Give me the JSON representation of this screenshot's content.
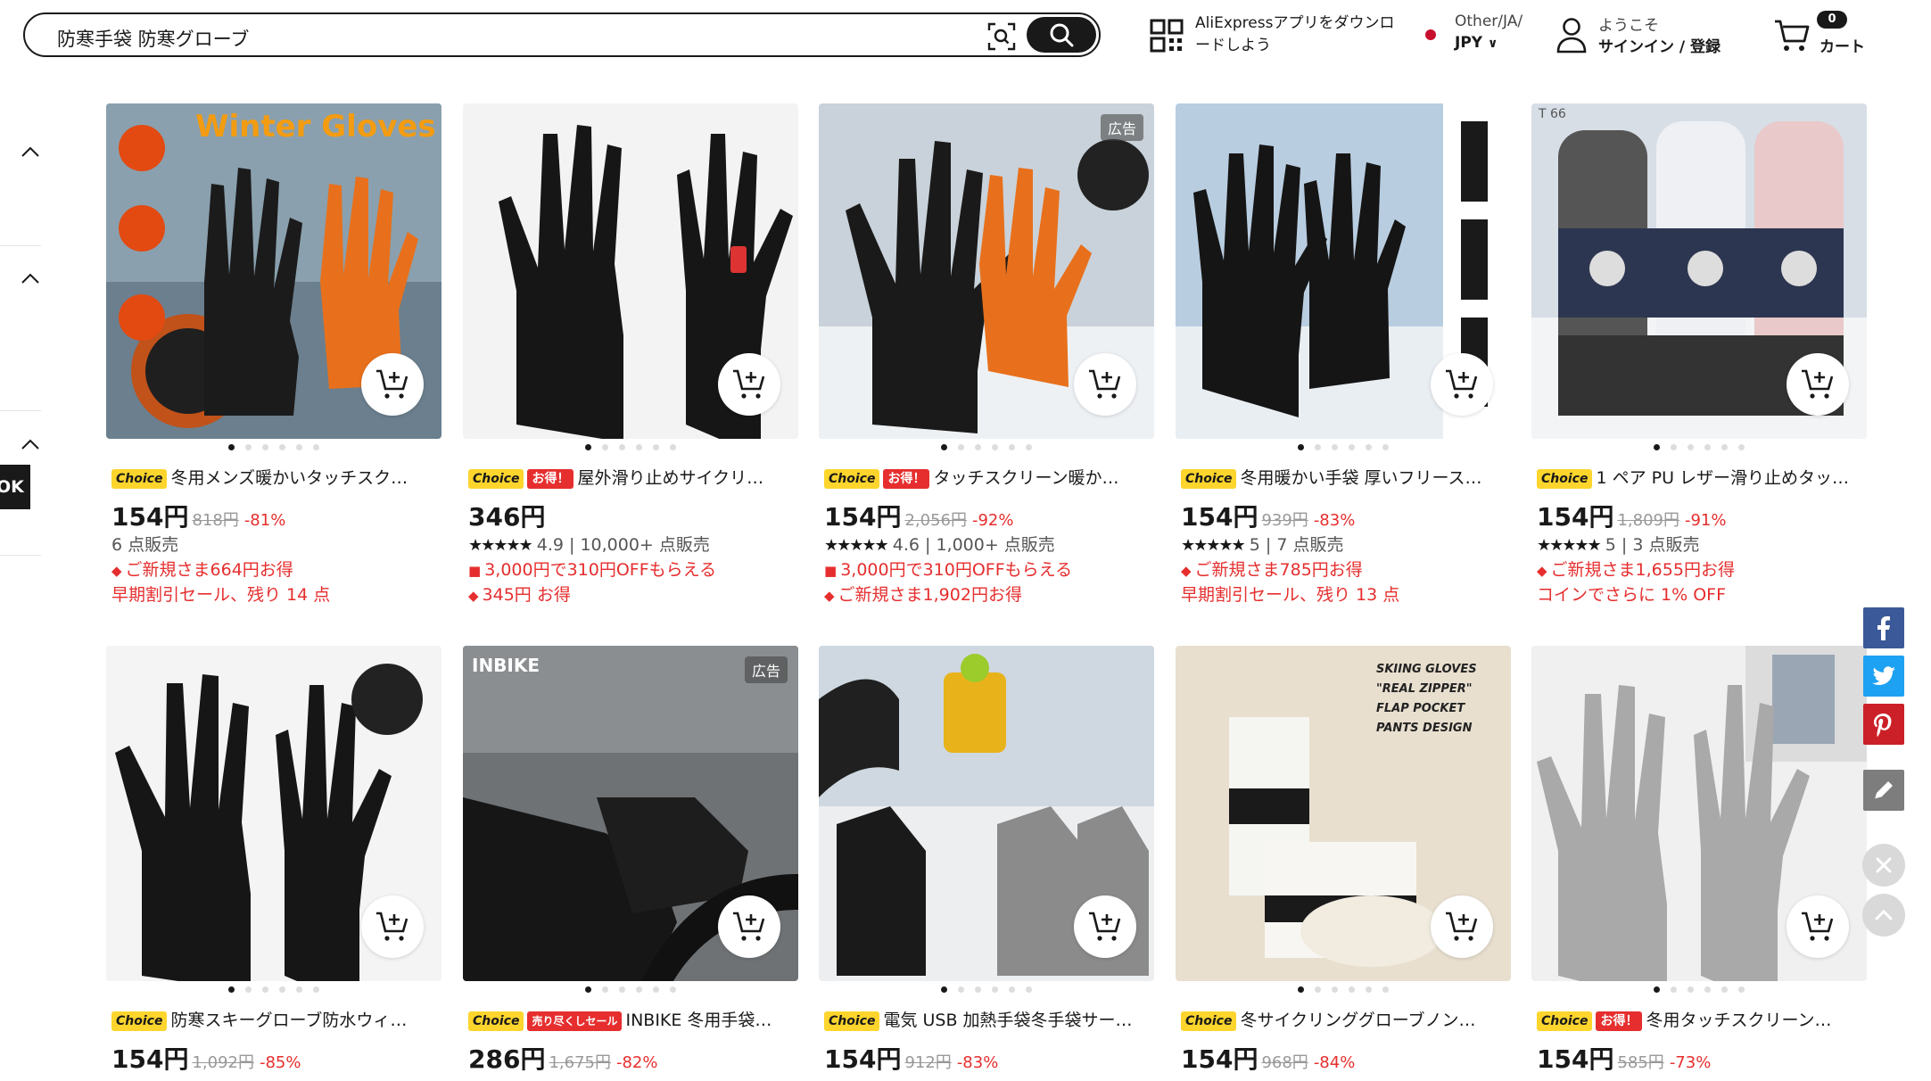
{
  "header": {
    "search_query": "防寒手袋 防寒グローブ",
    "app_download": "AliExpressアプリをダウンロードしよう",
    "region_top": "Other/JA/",
    "currency": "JPY",
    "welcome": "ようこそ",
    "signin": "サインイン / 登録",
    "cart_count": "0",
    "cart_label": "カート"
  },
  "left_panel": {
    "ok_label": "OK"
  },
  "ad_label": "広告",
  "products": [
    {
      "img_text": "Winter Gloves",
      "badges": [
        "Choice"
      ],
      "title": "冬用メンズ暖かいタッチスク…",
      "price": "154円",
      "orig": "818円",
      "disc": "-81%",
      "meta_rating": "",
      "meta": "6 点販売",
      "promos": [
        "ご新規さま664円お得",
        "早期割引セール、残り 14 点"
      ]
    },
    {
      "img_text": "",
      "badges": [
        "Choice",
        "お得！"
      ],
      "title": "屋外滑り止めサイクリ…",
      "price": "346円",
      "orig": "",
      "disc": "",
      "meta_rating": "4.9",
      "meta": "10,000+ 点販売",
      "promos": [
        "3,000円で310円OFFもらえる",
        "345円 お得"
      ]
    },
    {
      "img_text": "",
      "badges": [
        "Choice",
        "お得！"
      ],
      "title": "タッチスクリーン暖か…",
      "price": "154円",
      "orig": "2,056円",
      "disc": "-92%",
      "meta_rating": "4.6",
      "meta": "1,000+ 点販売",
      "promos": [
        "3,000円で310円OFFもらえる",
        "ご新規さま1,902円お得"
      ]
    },
    {
      "img_text": "",
      "badges": [
        "Choice"
      ],
      "title": "冬用暖かい手袋 厚いフリース…",
      "price": "154円",
      "orig": "939円",
      "disc": "-83%",
      "meta_rating": "5",
      "meta": "7 点販売",
      "promos": [
        "ご新規さま785円お得",
        "早期割引セール、残り 13 点"
      ]
    },
    {
      "img_text": "T 66",
      "badges": [
        "Choice"
      ],
      "title": "1 ペア PU レザー滑り止めタッ…",
      "price": "154円",
      "orig": "1,809円",
      "disc": "-91%",
      "meta_rating": "5",
      "meta": "3 点販売",
      "promos": [
        "ご新規さま1,655円お得",
        "コインでさらに 1% OFF"
      ]
    },
    {
      "img_text": "",
      "badges": [
        "Choice"
      ],
      "title": "防寒スキーグローブ防水ウィ…",
      "price": "154円",
      "orig": "1,092円",
      "disc": "-85%"
    },
    {
      "img_text": "INBIKE",
      "badges": [
        "Choice",
        "売り尽くしセール"
      ],
      "title": "INBIKE 冬用手袋…",
      "price": "286円",
      "orig": "1,675円",
      "disc": "-82%"
    },
    {
      "img_text": "",
      "badges": [
        "Choice"
      ],
      "title": "電気 USB 加熱手袋冬手袋サー…",
      "price": "154円",
      "orig": "912円",
      "disc": "-83%"
    },
    {
      "img_text": "SKIING GLOVES \"REAL ZIPPER\" FLAP POCKET PANTS DESIGN",
      "badges": [
        "Choice"
      ],
      "title": "冬サイクリンググローブノン…",
      "price": "154円",
      "orig": "968円",
      "disc": "-84%"
    },
    {
      "img_text": "",
      "badges": [
        "Choice",
        "お得！"
      ],
      "title": "冬用タッチスクリーン…",
      "price": "154円",
      "orig": "585円",
      "disc": "-73%"
    }
  ],
  "colors": {
    "accent_red": "#e62e2e",
    "choice_yellow": "#fdd52d",
    "dark": "#191919"
  }
}
